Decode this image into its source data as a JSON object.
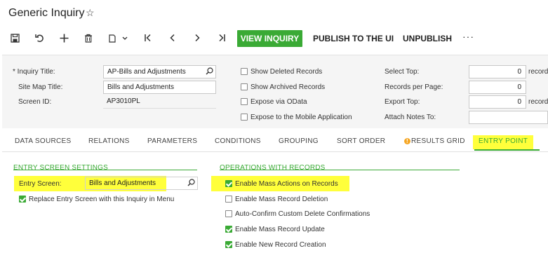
{
  "window": {
    "title": "Generic Inquiry"
  },
  "toolbar": {
    "icons": [
      "save-icon",
      "undo-icon",
      "add-icon",
      "delete-icon",
      "copy-paste-icon",
      "first-icon",
      "previous-icon",
      "next-icon",
      "last-icon"
    ],
    "view_inquiry": "VIEW INQUIRY",
    "publish": "PUBLISH TO THE UI",
    "unpublish": "UNPUBLISH",
    "more": "···",
    "accent_color": "#3aaa35"
  },
  "header": {
    "inquiry_title_label": "Inquiry Title:",
    "inquiry_title_value": "AP-Bills and Adjustments",
    "site_map_title_label": "Site Map Title:",
    "site_map_title_value": "Bills and Adjustments",
    "screen_id_label": "Screen ID:",
    "screen_id_value": "AP3010PL",
    "options": {
      "show_deleted": "Show Deleted Records",
      "show_archived": "Show Archived Records",
      "expose_odata": "Expose via OData",
      "expose_mobile": "Expose to the Mobile Application"
    },
    "select_top_label": "Select Top:",
    "select_top_value": "0",
    "select_top_suffix": "record",
    "records_per_page_label": "Records per Page:",
    "records_per_page_value": "0",
    "export_top_label": "Export Top:",
    "export_top_value": "0",
    "export_top_suffix": "record",
    "attach_notes_label": "Attach Notes To:",
    "attach_notes_value": ""
  },
  "tabs": [
    "DATA SOURCES",
    "RELATIONS",
    "PARAMETERS",
    "CONDITIONS",
    "GROUPING",
    "SORT ORDER",
    "RESULTS GRID",
    "ENTRY POINT"
  ],
  "entry_screen_settings": {
    "title": "ENTRY SCREEN SETTINGS",
    "entry_screen_label": "Entry Screen:",
    "entry_screen_value": "Bills and Adjustments",
    "replace_label": "Replace Entry Screen with this Inquiry in Menu"
  },
  "operations": {
    "title": "OPERATIONS WITH RECORDS",
    "items": [
      {
        "label": "Enable Mass Actions on Records",
        "checked": true
      },
      {
        "label": "Enable Mass Record Deletion",
        "checked": false
      },
      {
        "label": "Auto-Confirm Custom Delete Confirmations",
        "checked": false
      },
      {
        "label": "Enable Mass Record Update",
        "checked": true
      },
      {
        "label": "Enable New Record Creation",
        "checked": true
      }
    ]
  },
  "highlight_color": "#ffff3b"
}
